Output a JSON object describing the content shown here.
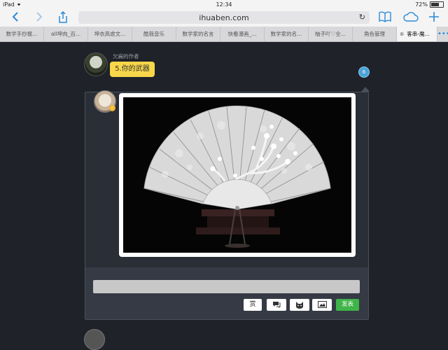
{
  "status": {
    "device": "iPad",
    "time": "12:34",
    "battery": "72%"
  },
  "browser": {
    "url": "ihuaben.com",
    "more": "•••"
  },
  "tabs": [
    {
      "label": "数学手抄报..."
    },
    {
      "label": "all坤肉_百..."
    },
    {
      "label": "坤衣高虐文..."
    },
    {
      "label": "酷我音乐"
    },
    {
      "label": "数学家的名言"
    },
    {
      "label": "快看漫画_..."
    },
    {
      "label": "数学家的名..."
    },
    {
      "label": "柚子吖♡全..."
    },
    {
      "label": "角色管理"
    },
    {
      "label": "客串-魔..."
    }
  ],
  "post": {
    "author": "欠扁的作者",
    "message": "5.你的武器",
    "count": "6"
  },
  "actions": {
    "reward": "赏",
    "post_label": "发表"
  },
  "icons": {
    "back": "chevron-left-icon",
    "forward": "chevron-right-icon",
    "share": "share-icon",
    "reload": "reload-icon",
    "bookmarks": "book-icon",
    "cloud": "cloud-icon",
    "add": "plus-icon",
    "chat": "chat-bubble-icon",
    "emoji": "cat-face-icon",
    "image": "image-icon"
  },
  "colors": {
    "accent": "#2a8ad8",
    "bubble": "#f7d64a",
    "post_button": "#3fb449",
    "page_bg": "#1f2229"
  }
}
